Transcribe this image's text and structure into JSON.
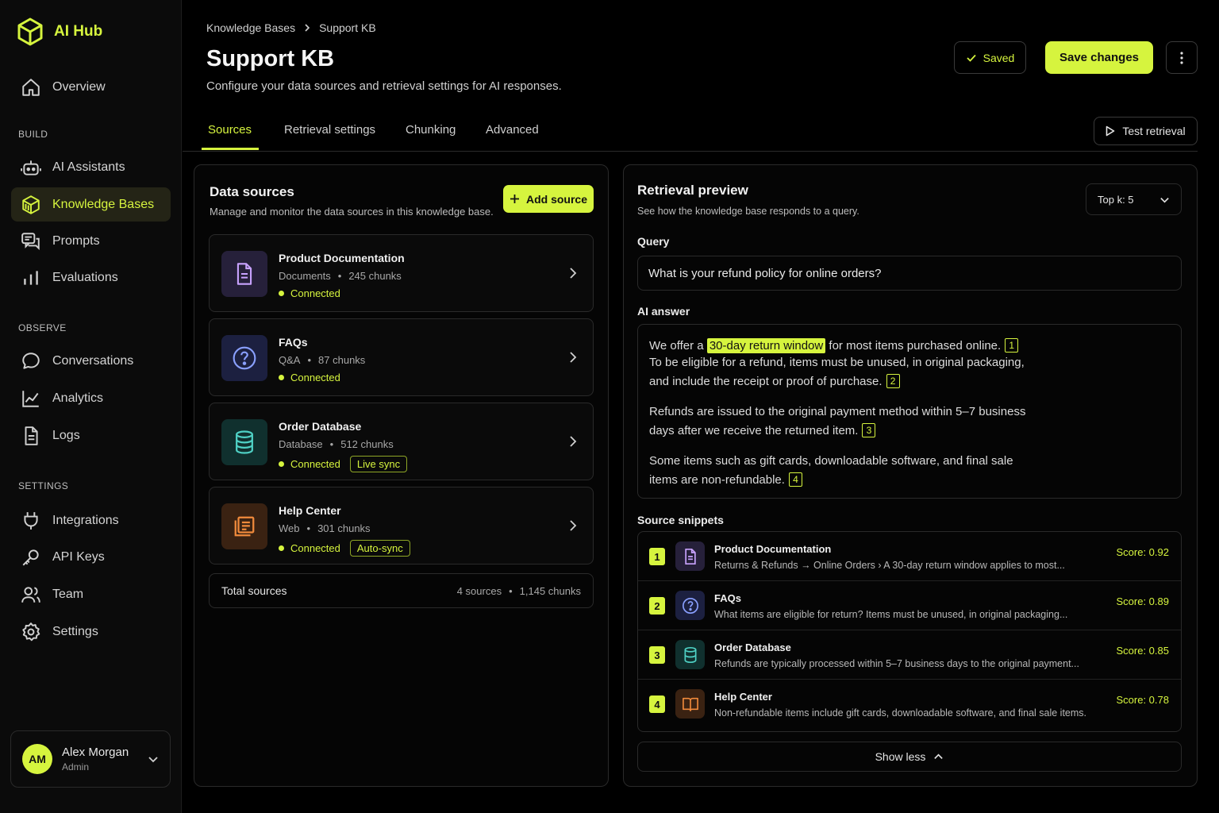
{
  "app": {
    "name": "AI Hub",
    "accent": "#d6f43e"
  },
  "sidebar": {
    "overview": "Overview",
    "sections": {
      "build": "BUILD",
      "observe": "OBSERVE",
      "settings": "SETTINGS"
    },
    "build_items": [
      {
        "label": "AI Assistants",
        "icon": "robot-icon"
      },
      {
        "label": "Knowledge Bases",
        "icon": "knowledge-base-icon",
        "active": true
      },
      {
        "label": "Prompts",
        "icon": "prompts-icon"
      },
      {
        "label": "Evaluations",
        "icon": "bar-chart-icon"
      }
    ],
    "observe_items": [
      {
        "label": "Conversations",
        "icon": "chat-bubble-icon"
      },
      {
        "label": "Analytics",
        "icon": "line-chart-icon"
      },
      {
        "label": "Logs",
        "icon": "document-icon"
      }
    ],
    "settings_items": [
      {
        "label": "Integrations",
        "icon": "plug-icon"
      },
      {
        "label": "API Keys",
        "icon": "key-icon"
      },
      {
        "label": "Team",
        "icon": "team-icon"
      },
      {
        "label": "Settings",
        "icon": "gear-icon"
      }
    ],
    "user": {
      "initials": "AM",
      "name": "Alex Morgan",
      "role": "Admin"
    }
  },
  "header": {
    "breadcrumb": [
      "Knowledge Bases",
      "Support KB"
    ],
    "title": "Support KB",
    "subtitle": "Configure your data sources and retrieval settings for AI responses.",
    "saved_label": "Saved",
    "save_label": "Save changes"
  },
  "tabs": [
    "Sources",
    "Retrieval settings",
    "Chunking",
    "Advanced"
  ],
  "active_tab": "Sources",
  "test_retrieval": "Test retrieval",
  "data_sources": {
    "title": "Data sources",
    "subtitle": "Manage and monitor the data sources in this knowledge base.",
    "add_label": "Add source",
    "items": [
      {
        "name": "Product Documentation",
        "type": "Documents",
        "chunks": "245 chunks",
        "status": "Connected",
        "badge": "",
        "icon": "document-icon"
      },
      {
        "name": "FAQs",
        "type": "Q&A",
        "chunks": "87 chunks",
        "status": "Connected",
        "badge": "",
        "icon": "question-icon"
      },
      {
        "name": "Order Database",
        "type": "Database",
        "chunks": "512 chunks",
        "status": "Connected",
        "badge": "Live sync",
        "icon": "database-icon"
      },
      {
        "name": "Help Center",
        "type": "Web",
        "chunks": "301 chunks",
        "status": "Connected",
        "badge": "Auto-sync",
        "icon": "book-icon"
      }
    ],
    "total_label": "Total sources",
    "total_sources": "4 sources",
    "total_chunks": "1,145 chunks"
  },
  "retrieval_preview": {
    "title": "Retrieval preview",
    "subtitle": "See how the knowledge base responds to a query.",
    "topk": "Top k: 5",
    "query_label": "Query",
    "query": "What is your refund policy for online orders?",
    "answer_label": "AI answer",
    "answer": {
      "l1_pre": "We offer a",
      "l1_hl": "30-day return window",
      "l1_post": "for most items purchased online.",
      "l2": "To be eligible for a refund, items must be unused, in original packaging,",
      "l3": "and include the receipt or proof of purchase.",
      "l4": "Refunds are issued to the original payment method within 5–7 business",
      "l5": "days after we receive the returned item.",
      "l6": "Some items such as gift cards, downloadable software, and final sale",
      "l7": "items are non-refundable.",
      "c1": "1",
      "c2": "2",
      "c3": "3",
      "c4": "4"
    },
    "snippets_label": "Source snippets",
    "snippets": [
      {
        "num": "1",
        "name": "Product Documentation",
        "text": "Returns & Refunds → Online Orders  ›  A 30-day return window applies to most...",
        "score": "Score: 0.92"
      },
      {
        "num": "2",
        "name": "FAQs",
        "text": "What items are eligible for return? Items must be unused, in original packaging...",
        "score": "Score: 0.89"
      },
      {
        "num": "3",
        "name": "Order Database",
        "text": "Refunds are typically processed within 5–7 business days to the original payment...",
        "score": "Score: 0.85"
      },
      {
        "num": "4",
        "name": "Help Center",
        "text": "Non-refundable items include gift cards, downloadable software, and final sale items.",
        "score": "Score: 0.78"
      }
    ],
    "show_less": "Show less"
  }
}
